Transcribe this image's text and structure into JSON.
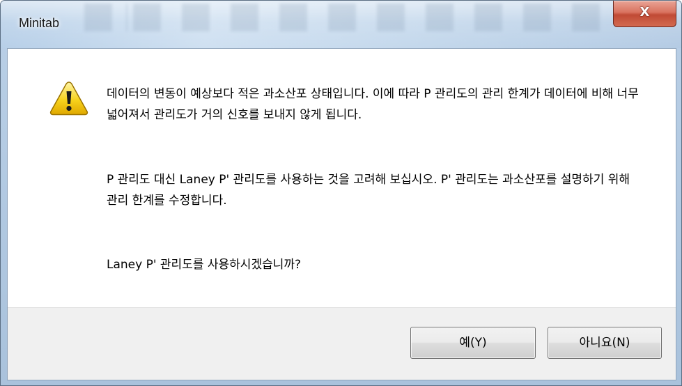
{
  "window": {
    "title": "Minitab",
    "close_label": "X"
  },
  "message": {
    "paragraph1": "데이터의 변동이 예상보다 적은 과소산포 상태입니다. 이에 따라 P 관리도의 관리 한계가 데이터에 비해 너무 넓어져서 관리도가 거의 신호를 보내지 않게 됩니다.",
    "paragraph2": "P 관리도 대신 Laney P' 관리도를 사용하는 것을 고려해 보십시오. P' 관리도는 과소산포를 설명하기 위해 관리 한계를 수정합니다.",
    "question": "Laney P' 관리도를 사용하시겠습니까?"
  },
  "buttons": {
    "yes_label": "예(Y)",
    "no_label": "아니요(N)"
  },
  "icon": {
    "name": "warning-icon",
    "color": "#f2c200"
  }
}
